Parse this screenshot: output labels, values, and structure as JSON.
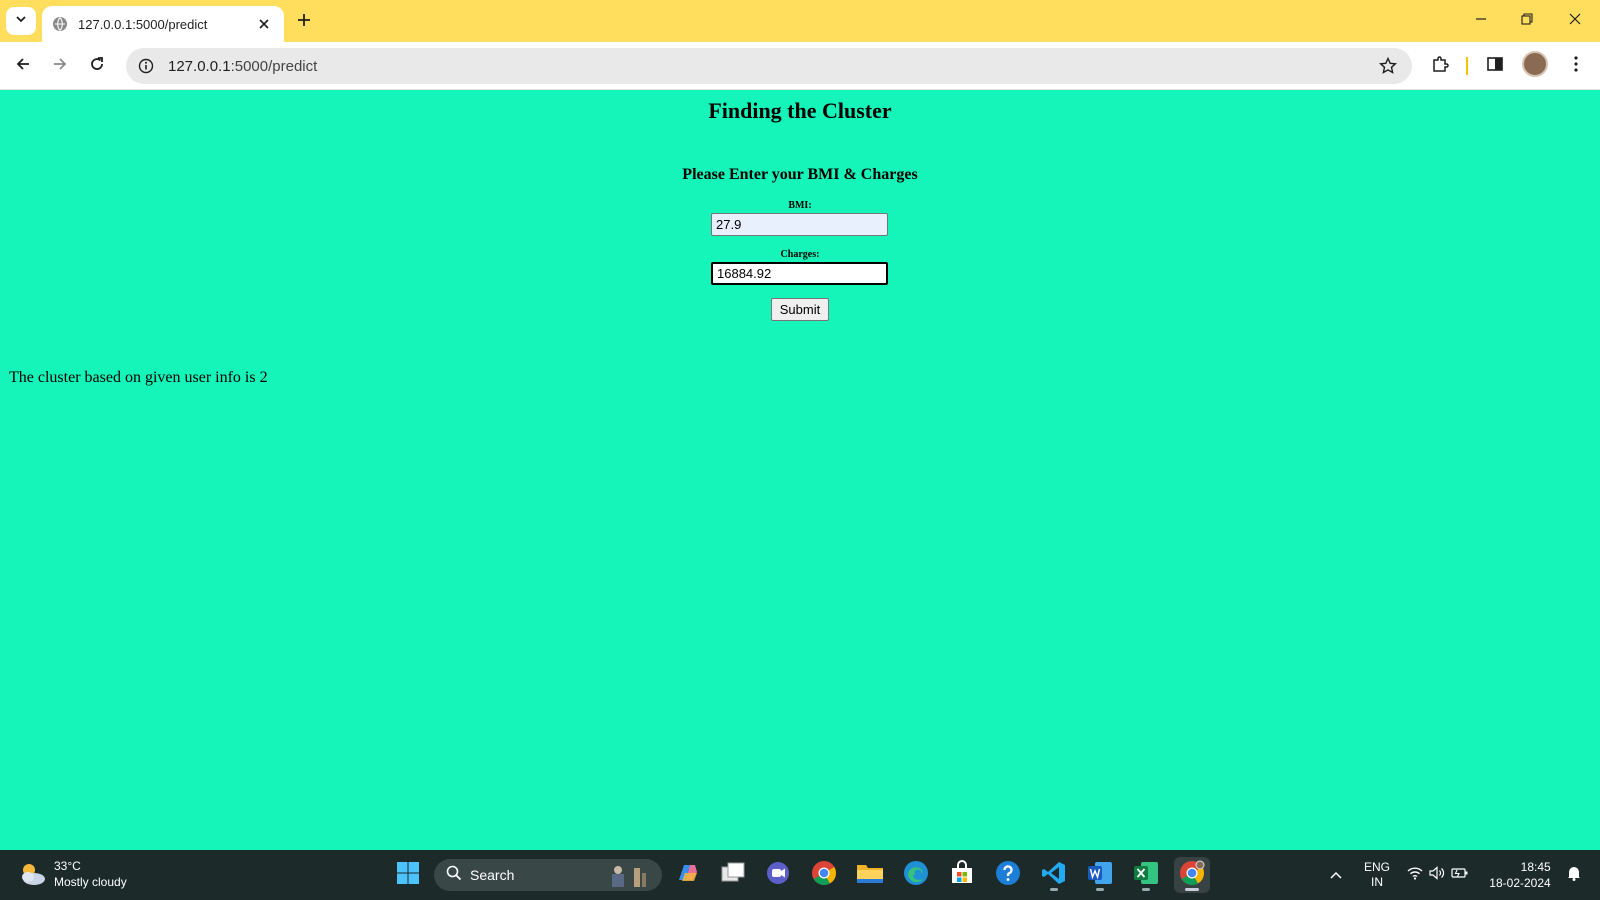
{
  "browser": {
    "tab_title": "127.0.0.1:5000/predict",
    "url_host": "127.0.0.1",
    "url_rest": ":5000/predict"
  },
  "page": {
    "heading": "Finding the Cluster",
    "subheading": "Please Enter your BMI & Charges",
    "bmi_label": "BMI:",
    "bmi_value": "27.9",
    "charges_label": "Charges:",
    "charges_value": "16884.92",
    "submit_label": "Submit",
    "result_text": "The cluster based on given user info is 2"
  },
  "taskbar": {
    "weather_temp": "33°C",
    "weather_desc": "Mostly cloudy",
    "search_label": "Search",
    "lang_line1": "ENG",
    "lang_line2": "IN",
    "time": "18:45",
    "date": "18-02-2024"
  },
  "colors": {
    "page_background": "#16f5b9",
    "tab_strip": "#ffde5e",
    "taskbar": "#1c2a2a"
  },
  "icons": [
    "tab-search-icon",
    "favicon-icon",
    "close-icon",
    "plus-icon",
    "minimize-icon",
    "restore-icon",
    "back-arrow-icon",
    "forward-arrow-icon",
    "reload-icon",
    "info-icon",
    "star-icon",
    "extensions-icon",
    "side-panel-icon",
    "profile-avatar",
    "menu-dots-icon",
    "weather-icon",
    "windows-start-icon",
    "search-icon",
    "copilot-icon",
    "task-view-icon",
    "teams-icon",
    "chrome-icon",
    "file-explorer-icon",
    "edge-icon",
    "store-icon",
    "help-icon",
    "vscode-icon",
    "word-icon",
    "excel-icon",
    "chevron-up-icon",
    "wifi-icon",
    "volume-icon",
    "battery-icon",
    "bell-icon"
  ]
}
